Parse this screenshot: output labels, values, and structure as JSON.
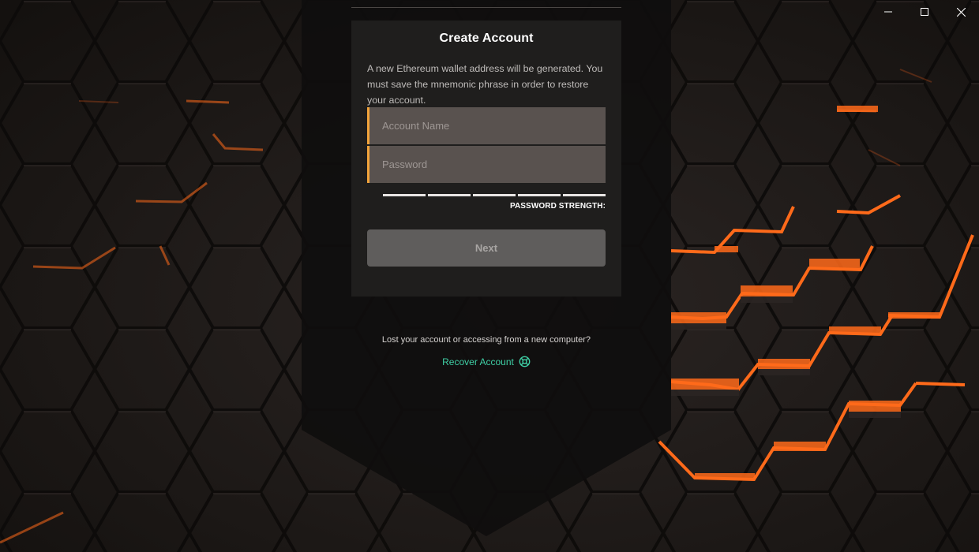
{
  "window": {
    "controls": {
      "minimize_icon": "minimize-icon",
      "maximize_icon": "maximize-icon",
      "close_icon": "close-icon"
    }
  },
  "card": {
    "title": "Create Account",
    "description": "A new Ethereum wallet address will be generated. You must save the mnemonic phrase in order to restore your account.",
    "account_name": {
      "placeholder": "Account Name",
      "value": ""
    },
    "password": {
      "placeholder": "Password",
      "value": ""
    },
    "strength": {
      "label": "PASSWORD STRENGTH:",
      "segments": 5,
      "level": 0
    },
    "next_label": "Next"
  },
  "footer": {
    "lost_text": "Lost your account or accessing from a new computer?",
    "recover_label": "Recover Account",
    "recover_icon": "lifebuoy-icon"
  },
  "colors": {
    "accent_orange": "#f2a33a",
    "link_green": "#3fcfa5",
    "glow_orange": "#ff6a1a"
  }
}
